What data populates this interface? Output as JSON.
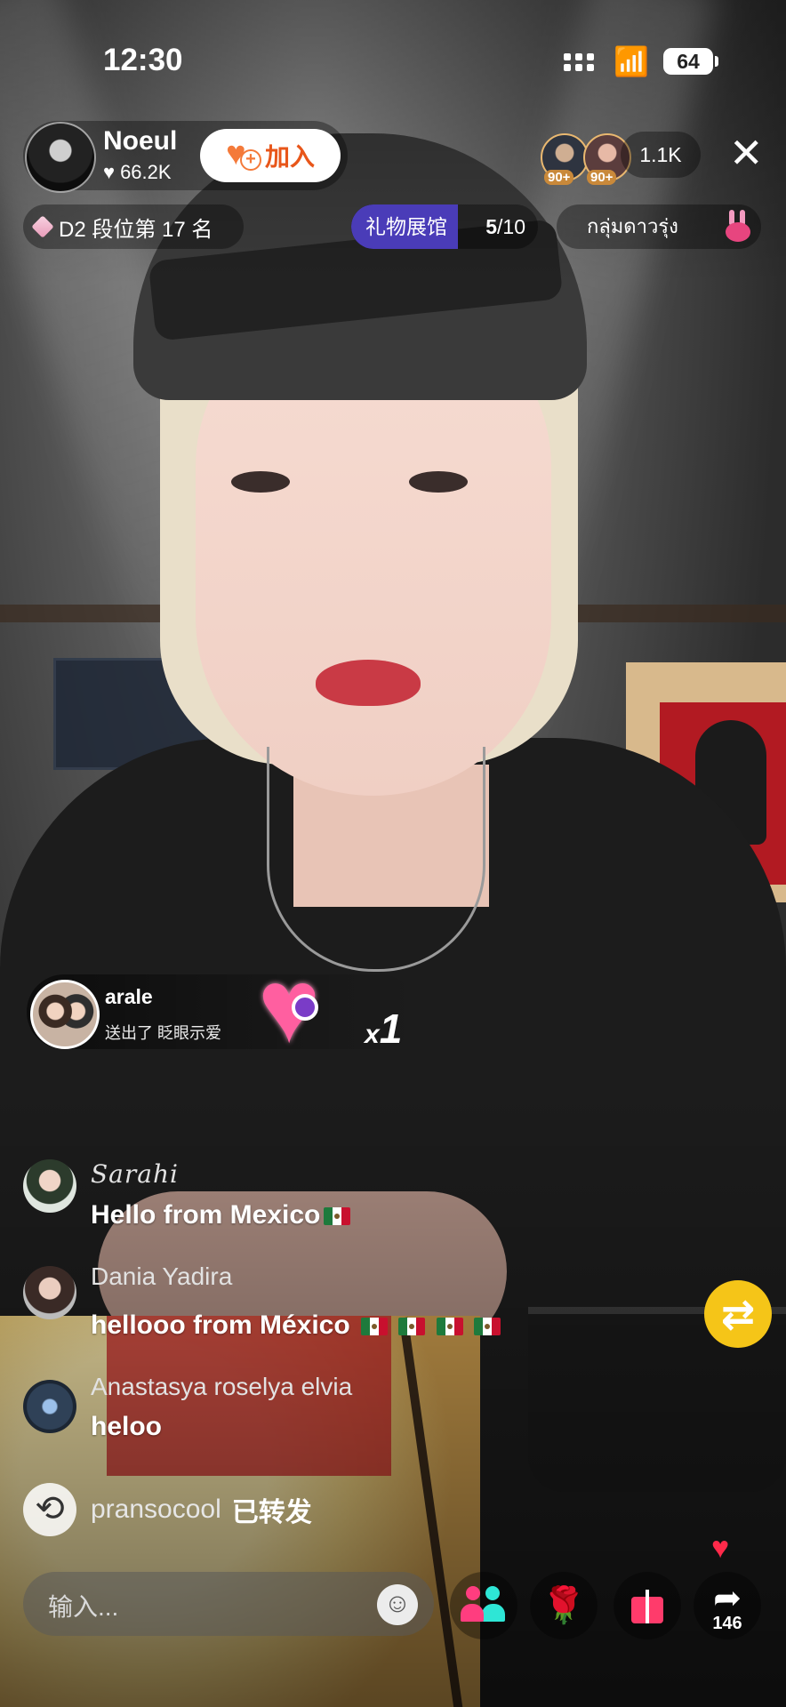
{
  "status_bar": {
    "time": "12:30",
    "battery": "64"
  },
  "host": {
    "name": "Noeul",
    "likes": "66.2K",
    "join_label": "加入"
  },
  "viewers": {
    "badge_a": "90+",
    "badge_b": "90+",
    "count": "1.1K"
  },
  "rank": {
    "label": "D2 段位第 17 名"
  },
  "gift_hall": {
    "label": "礼物展馆",
    "current": "5",
    "total": "/10"
  },
  "thai_group": {
    "label": "กลุ่มดาวรุ่ง"
  },
  "gift_notice": {
    "sender": "arale",
    "text": "送出了 眨眼示爱",
    "multiplier": "x",
    "count": "1"
  },
  "comments": [
    {
      "user": "Sarahi",
      "text": "Hello from Mexico"
    },
    {
      "user": "Dania Yadira",
      "text": "hellooo from México"
    },
    {
      "user": "Anastasya roselya elvia",
      "text": "heloo"
    }
  ],
  "repost": {
    "user": "pransocool",
    "action": "已转发"
  },
  "input": {
    "placeholder": "输入..."
  },
  "share": {
    "count": "146"
  },
  "colors": {
    "join_orange": "#e8561a",
    "gift_hall_purple": "#4a3cb8",
    "share_yellow": "#f5c518",
    "like_red": "#ff2a4a"
  }
}
